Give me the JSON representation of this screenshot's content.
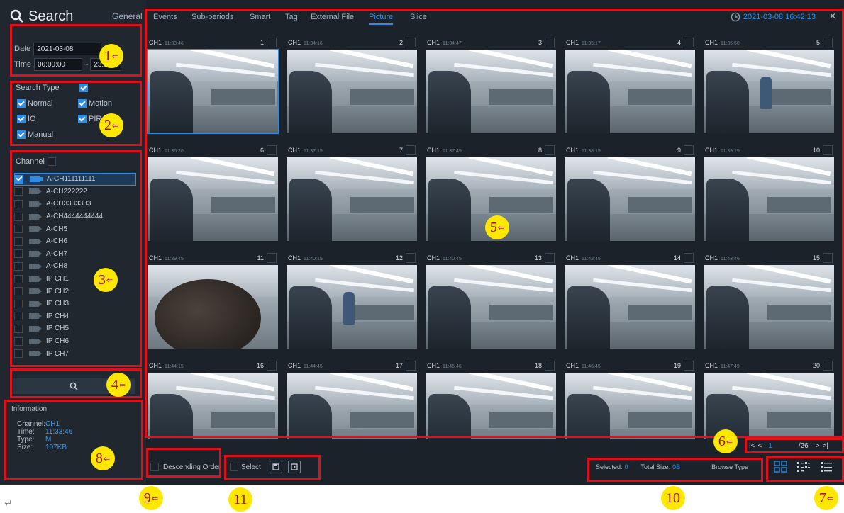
{
  "header": {
    "title": "Search",
    "general_tab": "General"
  },
  "tabs": [
    "Events",
    "Sub-periods",
    "Smart",
    "Tag",
    "External File",
    "Picture",
    "Slice"
  ],
  "active_tab": "Picture",
  "datetime": "2021-03-08 16:42:13",
  "close_label": "×",
  "date": {
    "label": "Date",
    "value": "2021-03-08"
  },
  "time": {
    "label": "Time",
    "start": "00:00:00",
    "end": "23:59"
  },
  "search_type": {
    "label": "Search Type",
    "options": [
      {
        "label": "Normal",
        "checked": true
      },
      {
        "label": "Motion",
        "checked": true
      },
      {
        "label": "IO",
        "checked": true
      },
      {
        "label": "PIR",
        "checked": true
      },
      {
        "label": "Manual",
        "checked": true
      }
    ]
  },
  "channel": {
    "label": "Channel",
    "items": [
      "A-CH111111111",
      "A-CH222222",
      "A-CH3333333",
      "A-CH4444444444",
      "A-CH5",
      "A-CH6",
      "A-CH7",
      "A-CH8",
      "IP CH1",
      "IP CH2",
      "IP CH3",
      "IP CH4",
      "IP CH5",
      "IP CH6",
      "IP CH7",
      "IP CH8"
    ]
  },
  "information": {
    "title": "Information",
    "channel_label": "Channel:",
    "channel": "CH1",
    "time_label": "Time:",
    "time": "11:33:46",
    "type_label": "Type:",
    "type": "M",
    "size_label": "Size:",
    "size": "107KB"
  },
  "pictures": [
    {
      "ch": "CH1",
      "time": "11:33:46",
      "num": "1"
    },
    {
      "ch": "CH1",
      "time": "11:34:16",
      "num": "2"
    },
    {
      "ch": "CH1",
      "time": "11:34:47",
      "num": "3"
    },
    {
      "ch": "CH1",
      "time": "11:35:17",
      "num": "4"
    },
    {
      "ch": "CH1",
      "time": "11:35:50",
      "num": "5"
    },
    {
      "ch": "CH1",
      "time": "11:36:20",
      "num": "6"
    },
    {
      "ch": "CH1",
      "time": "11:37:15",
      "num": "7"
    },
    {
      "ch": "CH1",
      "time": "11:37:45",
      "num": "8"
    },
    {
      "ch": "CH1",
      "time": "11:38:15",
      "num": "9"
    },
    {
      "ch": "CH1",
      "time": "11:39:15",
      "num": "10"
    },
    {
      "ch": "CH1",
      "time": "11:39:45",
      "num": "11"
    },
    {
      "ch": "CH1",
      "time": "11:40:15",
      "num": "12"
    },
    {
      "ch": "CH1",
      "time": "11:40:45",
      "num": "13"
    },
    {
      "ch": "CH1",
      "time": "11:42:45",
      "num": "14"
    },
    {
      "ch": "CH1",
      "time": "11:43:46",
      "num": "15"
    },
    {
      "ch": "CH1",
      "time": "11:44:15",
      "num": "16"
    },
    {
      "ch": "CH1",
      "time": "11:44:45",
      "num": "17"
    },
    {
      "ch": "CH1",
      "time": "11:45:46",
      "num": "18"
    },
    {
      "ch": "CH1",
      "time": "11:46:45",
      "num": "19"
    },
    {
      "ch": "CH1",
      "time": "11:47:49",
      "num": "20"
    }
  ],
  "pager": {
    "current": "1",
    "total": "/26"
  },
  "descending_label": "Descending Order",
  "select_label": "Select",
  "stats": {
    "selected_label": "Selected:",
    "selected": "0",
    "total_label": "Total Size:",
    "total": "0B",
    "browse_label": "Browse Type"
  },
  "callouts": [
    "1",
    "2",
    "3",
    "4",
    "5",
    "6",
    "7",
    "8",
    "9",
    "10",
    "11"
  ],
  "colors": {
    "accent": "#2e8ce6",
    "callout_border": "#e0101a",
    "callout_badge": "#ffe800"
  }
}
